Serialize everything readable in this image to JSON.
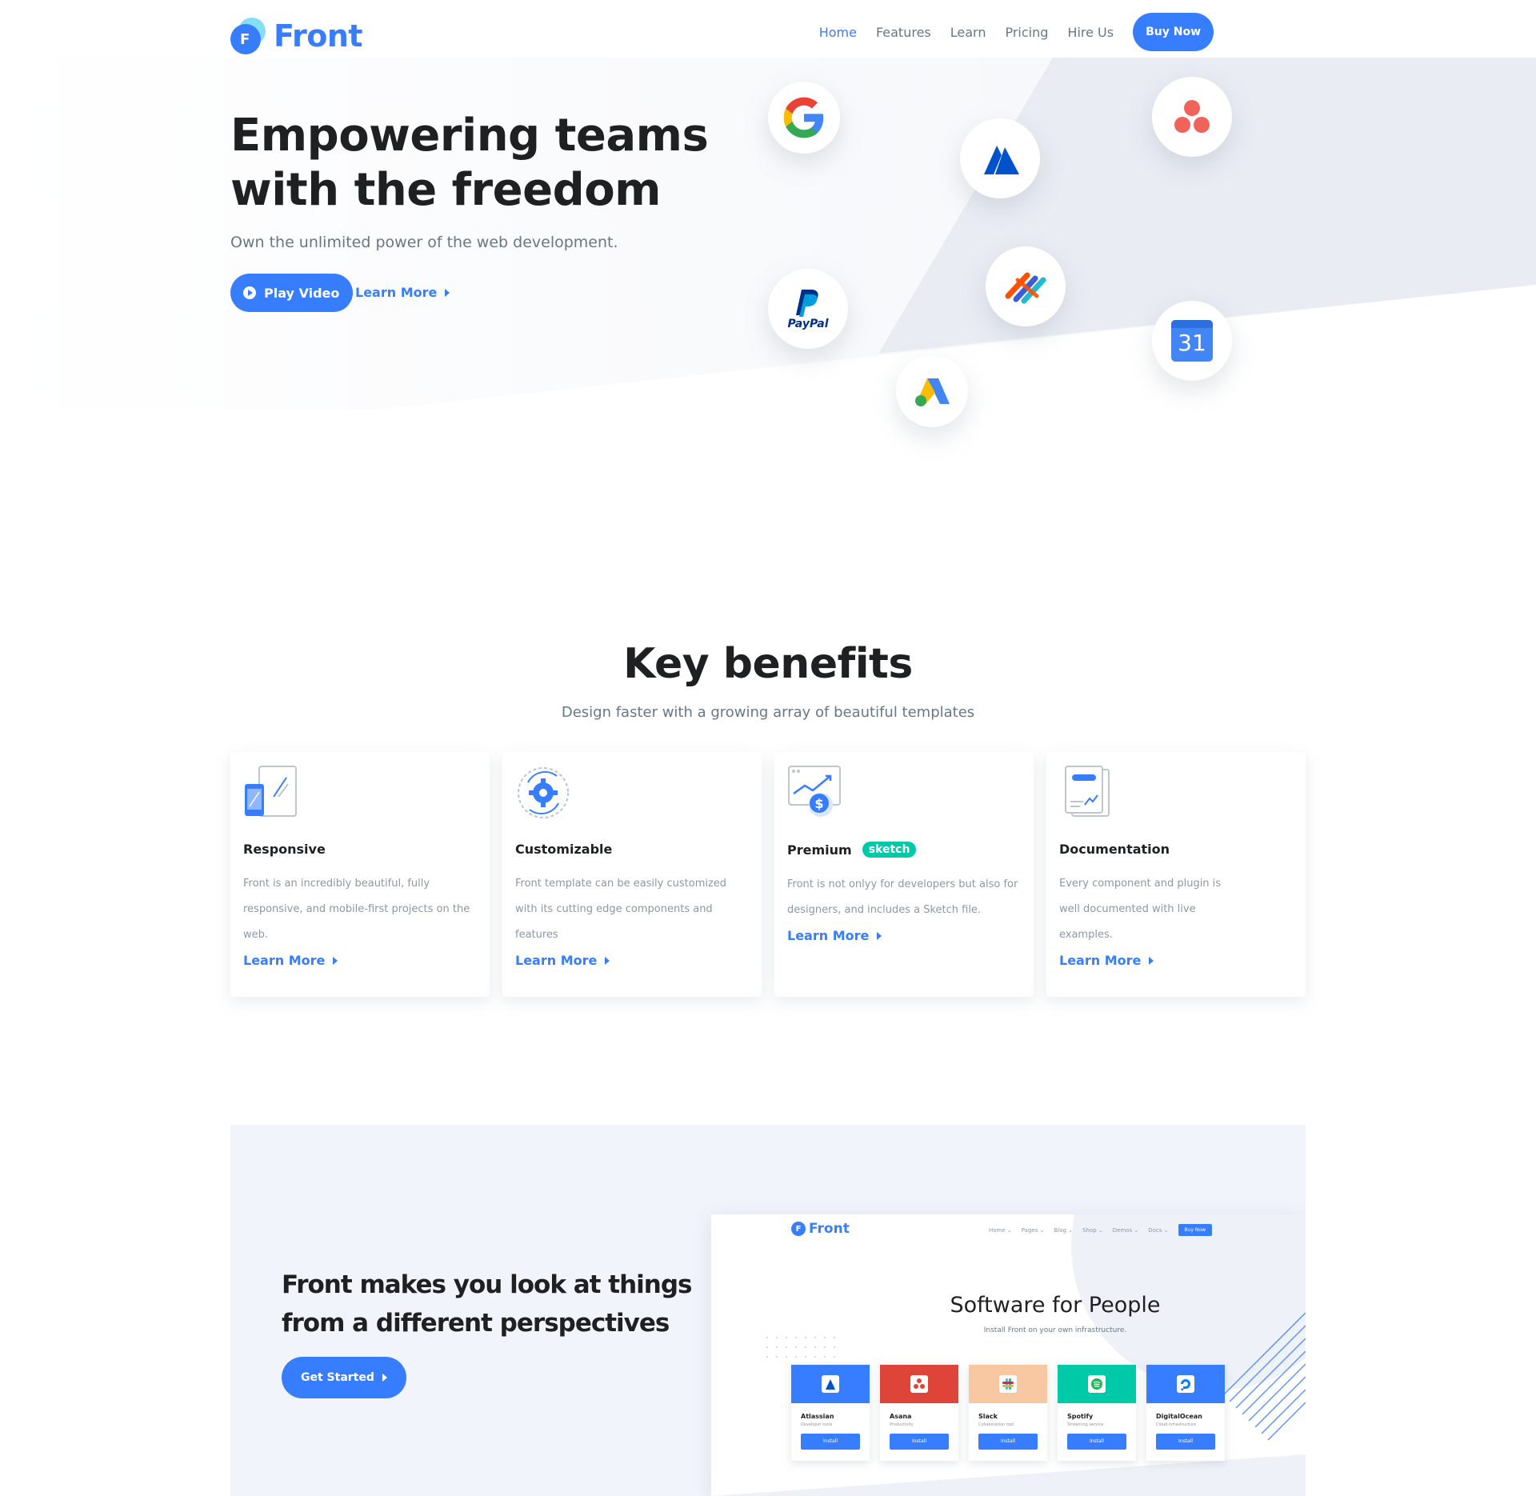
{
  "brand": {
    "name": "Front",
    "logo_letter": "F"
  },
  "nav": {
    "items": [
      {
        "label": "Home",
        "active": true
      },
      {
        "label": "Features"
      },
      {
        "label": "Learn"
      },
      {
        "label": "Pricing"
      },
      {
        "label": "Hire Us"
      }
    ],
    "buy_label": "Buy Now"
  },
  "hero": {
    "title_line1": "Empowering teams",
    "title_line2": "with the freedom",
    "subtitle": "Own the unlimited power of the web development.",
    "play_label": "Play Video",
    "learn_label": "Learn More",
    "calendar_day": "31",
    "paypal_text": "PayPal",
    "logos": [
      "google-icon",
      "atlassian-icon",
      "asana-icon",
      "paypal-icon",
      "zapier-icon",
      "google-calendar-icon",
      "google-ads-icon"
    ]
  },
  "benefits": {
    "title": "Key benefits",
    "subtitle": "Design faster with a growing array of beautiful templates",
    "cards": [
      {
        "title": "Responsive",
        "text": "Front is an incredibly beautiful, fully responsive, and mobile-first projects on the web.",
        "link": "Learn More",
        "icon": "devices-icon"
      },
      {
        "title": "Customizable",
        "text": "Front template can be easily customized with its cutting edge components and features",
        "link": "Learn More",
        "icon": "gear-icon"
      },
      {
        "title": "Premium",
        "badge": "sketch",
        "text": "Front is not onlyy for developers but also for designers, and includes a Sketch file.",
        "link": "Learn More",
        "icon": "chart-dollar-icon"
      },
      {
        "title": "Documentation",
        "text": "Every component and plugin is well documented with live examples.",
        "link": "Learn More",
        "icon": "document-icon"
      }
    ]
  },
  "cta": {
    "title_line1": "Front makes you look at things",
    "title_line2": "from a different perspectives",
    "button": "Get Started",
    "preview": {
      "brand": "Front",
      "nav": [
        "Home ⌄",
        "Pages ⌄",
        "Blog ⌄",
        "Shop ⌄",
        "Demos ⌄",
        "Docs ⌄"
      ],
      "buy": "Buy Now",
      "title": "Software for People",
      "subtitle": "Install Front on your own infrastructure.",
      "apps": [
        {
          "name": "Atlassian",
          "desc": "Developer tools",
          "color": "#377dff",
          "install": "Install"
        },
        {
          "name": "Asana",
          "desc": "Productivity",
          "color": "#de4437",
          "install": "Install"
        },
        {
          "name": "Slack",
          "desc": "Collaboration tool",
          "color": "#f7c8a1",
          "install": "Install"
        },
        {
          "name": "Spotify",
          "desc": "Streaming service",
          "color": "#00c9a7",
          "install": "Install"
        },
        {
          "name": "DigitalOcean",
          "desc": "Cloud infrastructure",
          "color": "#377dff",
          "install": "Install"
        }
      ]
    }
  },
  "colors": {
    "primary": "#377dff",
    "text": "#1e2022",
    "muted": "#677788",
    "success": "#00c9a7",
    "soft_bg": "#f1f4fb"
  }
}
